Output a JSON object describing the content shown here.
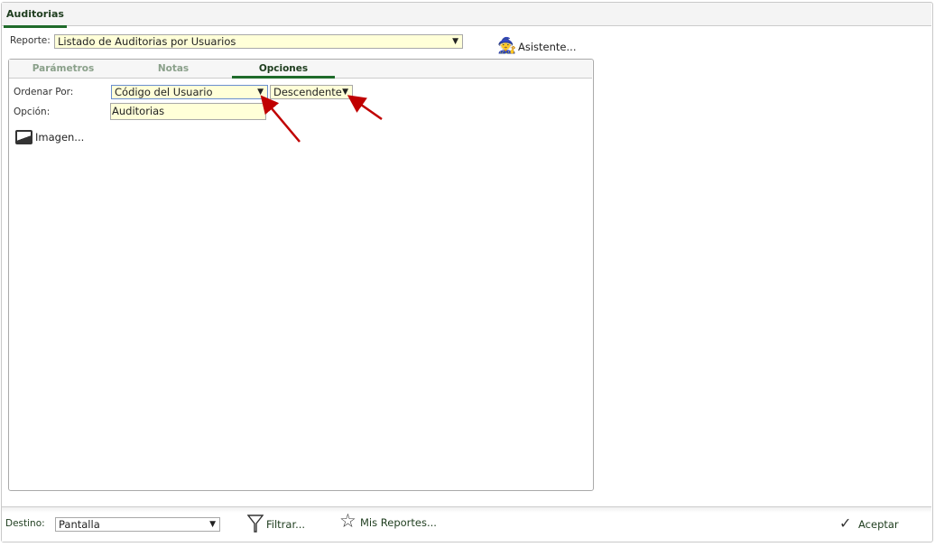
{
  "tab": {
    "title": "Auditorias"
  },
  "report": {
    "label": "Reporte:",
    "value": "Listado de Auditorias por Usuarios"
  },
  "wizard": {
    "label": "Asistente..."
  },
  "panel_tabs": [
    {
      "label": "Parámetros"
    },
    {
      "label": "Notas"
    },
    {
      "label": "Opciones",
      "active": true
    }
  ],
  "options": {
    "order_label": "Ordenar Por:",
    "order_value": "Código del Usuario",
    "direction_value": "Descendente",
    "option_label": "Opción:",
    "option_value": "Auditorias",
    "image_label": "Imagen..."
  },
  "footer": {
    "dest_label": "Destino:",
    "dest_value": "Pantalla",
    "filter_label": "Filtrar...",
    "my_reports_label": "Mis Reportes...",
    "accept_label": "Aceptar"
  },
  "colors": {
    "accent": "#1f6b2a",
    "field_bg": "#ffffd8",
    "arrow": "#c00000"
  }
}
